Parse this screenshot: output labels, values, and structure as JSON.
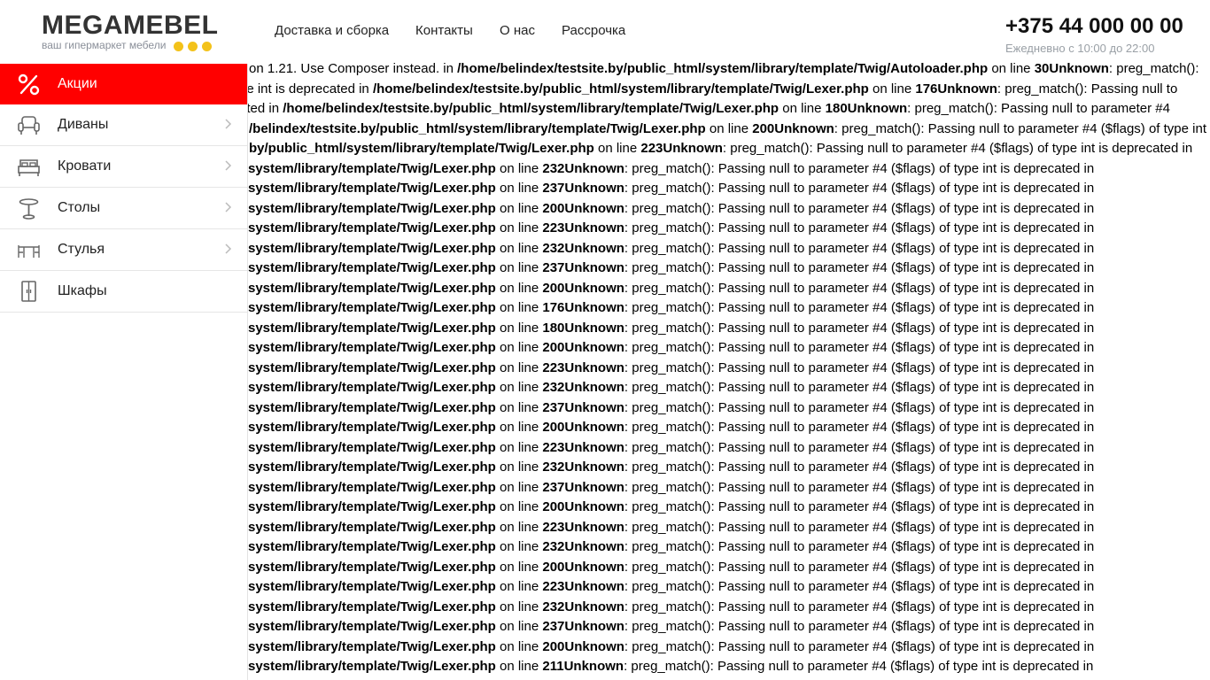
{
  "brand": {
    "name": "MEGAMEBEL",
    "tagline": "ваш гипермаркет мебели",
    "accent_color": "#f3c21a"
  },
  "nav": {
    "items": [
      "Доставка и сборка",
      "Контакты",
      "О нас",
      "Рассрочка"
    ]
  },
  "contact": {
    "phone": "+375 44 000 00 00",
    "hours": "Ежедневно с 10:00 до 22:00"
  },
  "sidebar": {
    "active_color": "#ff0000",
    "items": [
      {
        "label": "Акции",
        "icon": "percent-icon",
        "active": true,
        "has_submenu": false
      },
      {
        "label": "Диваны",
        "icon": "armchair-icon",
        "active": false,
        "has_submenu": true
      },
      {
        "label": "Кровати",
        "icon": "bed-icon",
        "active": false,
        "has_submenu": true
      },
      {
        "label": "Столы",
        "icon": "table-icon",
        "active": false,
        "has_submenu": true
      },
      {
        "label": "Стулья",
        "icon": "chairs-icon",
        "active": false,
        "has_submenu": true
      },
      {
        "label": "Шкафы",
        "icon": "wardrobe-icon",
        "active": false,
        "has_submenu": false
      }
    ]
  },
  "errors": {
    "header_lines": [
      {
        "pre": "on 1.21. Use Composer instead. in ",
        "file": "/home/belindex/testsite.by/public_html/system/library/template/Twig/Autoloader.php",
        "mid": " on line ",
        "line": "30Unknown",
        "post": ": preg_match():"
      },
      {
        "pre": "pe int is deprecated in ",
        "file": "/home/belindex/testsite.by/public_html/system/library/template/Twig/Lexer.php",
        "mid": " on line ",
        "line": "176Unknown",
        "post": ": preg_match(): Passing null to"
      },
      {
        "pre": "ated in ",
        "file": "/home/belindex/testsite.by/public_html/system/library/template/Twig/Lexer.php",
        "mid": " on line ",
        "line": "180Unknown",
        "post": ": preg_match(): Passing null to parameter #4"
      },
      {
        "pre": "",
        "file": "/belindex/testsite.by/public_html/system/library/template/Twig/Lexer.php",
        "mid": " on line ",
        "line": "200Unknown",
        "post": ": preg_match(): Passing null to parameter #4 ($flags) of type int"
      },
      {
        "pre": "",
        "file": "by/public_html/system/library/template/Twig/Lexer.php",
        "mid": " on line ",
        "line": "223Unknown",
        "post": ": preg_match(): Passing null to parameter #4 ($flags) of type int is deprecated in"
      }
    ],
    "repeat_file": "system/library/template/Twig/Lexer.php",
    "repeat_mid": " on line ",
    "repeat_post": ": preg_match(): Passing null to parameter #4 ($flags) of type int is deprecated in",
    "repeat_lines": [
      "232Unknown",
      "237Unknown",
      "200Unknown",
      "223Unknown",
      "232Unknown",
      "237Unknown",
      "200Unknown",
      "176Unknown",
      "180Unknown",
      "200Unknown",
      "223Unknown",
      "232Unknown",
      "237Unknown",
      "200Unknown",
      "223Unknown",
      "232Unknown",
      "237Unknown",
      "200Unknown",
      "223Unknown",
      "232Unknown",
      "200Unknown",
      "223Unknown",
      "232Unknown",
      "237Unknown",
      "200Unknown",
      "211Unknown"
    ]
  }
}
